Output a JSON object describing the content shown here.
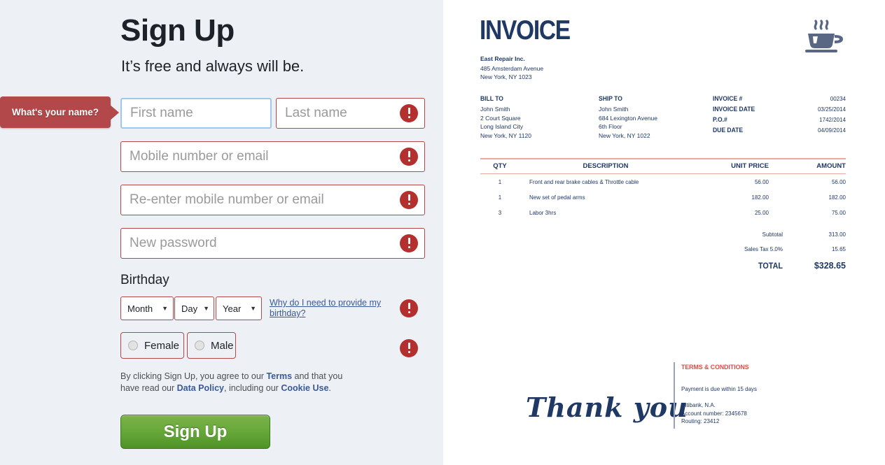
{
  "signup": {
    "title": "Sign Up",
    "subtitle": "It’s free and always will be.",
    "tooltip": "What's your name?",
    "fields": {
      "first_name_placeholder": "First name",
      "last_name_placeholder": "Last name",
      "mobile_placeholder": "Mobile number or email",
      "remobile_placeholder": "Re-enter mobile number or email",
      "password_placeholder": "New password"
    },
    "birthday": {
      "label": "Birthday",
      "month": "Month",
      "day": "Day",
      "year": "Year",
      "caret": "▼",
      "help_link": "Why do I need to provide my birthday?"
    },
    "gender": {
      "female": "Female",
      "male": "Male"
    },
    "terms": {
      "p1": "By clicking Sign Up, you agree to our ",
      "terms_link": "Terms",
      "p2": " and that you have read our ",
      "data_policy_link": "Data Policy",
      "p3": ", including our ",
      "cookie_link": "Cookie Use",
      "p4": "."
    },
    "submit_label": "Sign Up",
    "colors": {
      "panel_bg": "#edf1f5",
      "error_red": "#b3302f",
      "field_border_red": "#b3484a",
      "tooltip_bg": "#b3484a",
      "link_blue": "#3b5998",
      "button_green": "#67a839"
    }
  },
  "invoice": {
    "title": "INVOICE",
    "company": "East Repair Inc.",
    "address": "485 Amsterdam Avenue\nNew York, NY 1023",
    "bill_to": {
      "heading": "BILL TO",
      "lines": "John Smith\n2 Court Square\nLong Island City\nNew York, NY 1120"
    },
    "ship_to": {
      "heading": "SHIP TO",
      "lines": "John Smith\n684 Lexington Avenue\n6th Floor\nNew York, NY 1022"
    },
    "meta": [
      {
        "key": "INVOICE #",
        "value": "00234"
      },
      {
        "key": "INVOICE DATE",
        "value": "03/25/2014"
      },
      {
        "key": "P.O.#",
        "value": "1742/2014"
      },
      {
        "key": "DUE DATE",
        "value": "04/09/2014"
      }
    ],
    "table": {
      "headers": [
        "QTY",
        "DESCRIPTION",
        "UNIT PRICE",
        "AMOUNT"
      ],
      "rows": [
        {
          "qty": "1",
          "desc": "Front and rear brake cables & Throttle cable",
          "unit": "56.00",
          "amount": "56.00"
        },
        {
          "qty": "1",
          "desc": "New set of pedal arms",
          "unit": "182.00",
          "amount": "182.00"
        },
        {
          "qty": "3",
          "desc": "Labor 3hrs",
          "unit": "25.00",
          "amount": "75.00"
        }
      ]
    },
    "totals": [
      {
        "key": "Subtotal",
        "value": "313.00",
        "grand": false
      },
      {
        "key": "Sales Tax 5.0%",
        "value": "15.65",
        "grand": false
      },
      {
        "key": "TOTAL",
        "value": "$328.65",
        "grand": true
      }
    ],
    "thank_you": "Thank you",
    "terms_conditions": {
      "heading": "TERMS & CONDITIONS",
      "due": "Payment is due within 15 days",
      "bank": "Citibank, N.A.\nAccount number: 2345678\nRouting: 23412"
    },
    "colors": {
      "navy": "#1f3864",
      "rule_pink": "#e8a9a0",
      "terms_red": "#e04a43",
      "page_bg": "#ffffff"
    }
  }
}
